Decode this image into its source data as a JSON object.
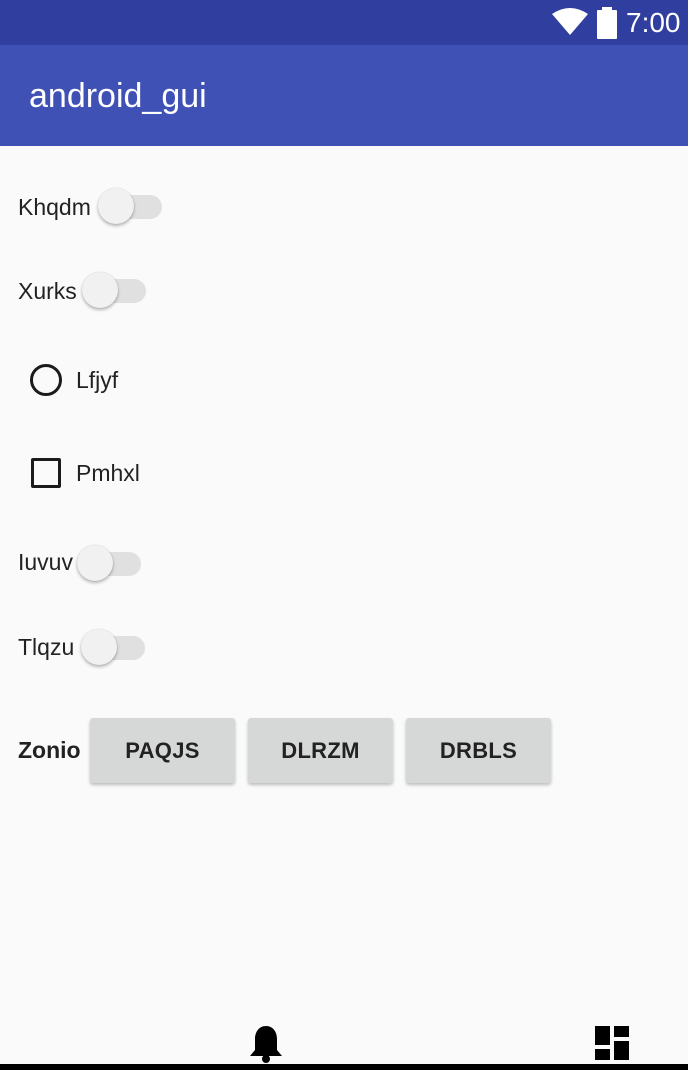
{
  "status_bar": {
    "time": "7:00",
    "icons": [
      "wifi-icon",
      "battery-icon"
    ],
    "color": "#303f9f"
  },
  "app_bar": {
    "title": "android_gui",
    "color": "#3f51b5"
  },
  "form": {
    "switch_1": {
      "label": "Khqdm",
      "checked": false
    },
    "switch_2": {
      "label": "Xurks",
      "checked": false
    },
    "radio_1": {
      "label": "Lfjyf",
      "checked": false
    },
    "checkbox_1": {
      "label": "Pmhxl",
      "checked": false
    },
    "switch_3": {
      "label": "Iuvuv",
      "checked": false
    },
    "switch_4": {
      "label": "Tlqzu",
      "checked": false
    },
    "button_group": {
      "label": "Zonio",
      "buttons": [
        "PAQJS",
        "DLRZM",
        "DRBLS"
      ]
    }
  },
  "bottom_bar": {
    "icons": [
      "bell-icon",
      "dashboard-icon"
    ]
  }
}
